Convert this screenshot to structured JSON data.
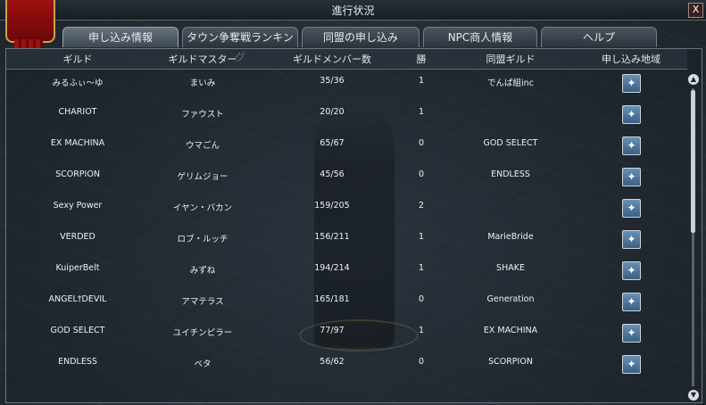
{
  "window": {
    "title": "進行状況",
    "close_glyph": "X"
  },
  "tabs": [
    {
      "label": "申し込み情報",
      "active": true
    },
    {
      "label": "タウン争奪戦ランキング",
      "active": false
    },
    {
      "label": "同盟の申し込み",
      "active": false
    },
    {
      "label": "NPC商人情報",
      "active": false
    },
    {
      "label": "ヘルプ",
      "active": false
    }
  ],
  "table": {
    "columns": [
      "ギルド",
      "ギルドマスター",
      "ギルドメンバー数",
      "勝",
      "同盟ギルド",
      "申し込み地域"
    ],
    "rows": [
      {
        "guild": "みるふぃ～ゆ",
        "master": "まいみ",
        "members": "35/36",
        "wins": "1",
        "alliance": "でんぱ組inc"
      },
      {
        "guild": "CHARIOT",
        "master": "ファウスト",
        "members": "20/20",
        "wins": "1",
        "alliance": ""
      },
      {
        "guild": "EX MACHINA",
        "master": "ウマごん",
        "members": "65/67",
        "wins": "0",
        "alliance": "GOD SELECT"
      },
      {
        "guild": "SCORPION",
        "master": "ゲリムジョー",
        "members": "45/56",
        "wins": "0",
        "alliance": "ENDLESS"
      },
      {
        "guild": "Sexy Power",
        "master": "イヤン・バカン",
        "members": "159/205",
        "wins": "2",
        "alliance": ""
      },
      {
        "guild": "VERDED",
        "master": "ロブ・ルッチ",
        "members": "156/211",
        "wins": "1",
        "alliance": "MarieBride"
      },
      {
        "guild": "KuiperBelt",
        "master": "みずね",
        "members": "194/214",
        "wins": "1",
        "alliance": "SHAKE"
      },
      {
        "guild": "ANGEL†DEVIL",
        "master": "アマテラス",
        "members": "165/181",
        "wins": "0",
        "alliance": "Generation"
      },
      {
        "guild": "GOD SELECT",
        "master": "ユイチンピラー",
        "members": "77/97",
        "wins": "1",
        "alliance": "EX MACHINA"
      },
      {
        "guild": "ENDLESS",
        "master": "ベタ",
        "members": "56/62",
        "wins": "0",
        "alliance": "SCORPION"
      }
    ]
  },
  "icons": {
    "region": "crystal-icon",
    "scroll_up": "chevron-up-icon",
    "scroll_down": "chevron-down-icon"
  },
  "colors": {
    "accent": "#5a86b0",
    "text": "#eef1f3",
    "banner": "#a01010"
  }
}
